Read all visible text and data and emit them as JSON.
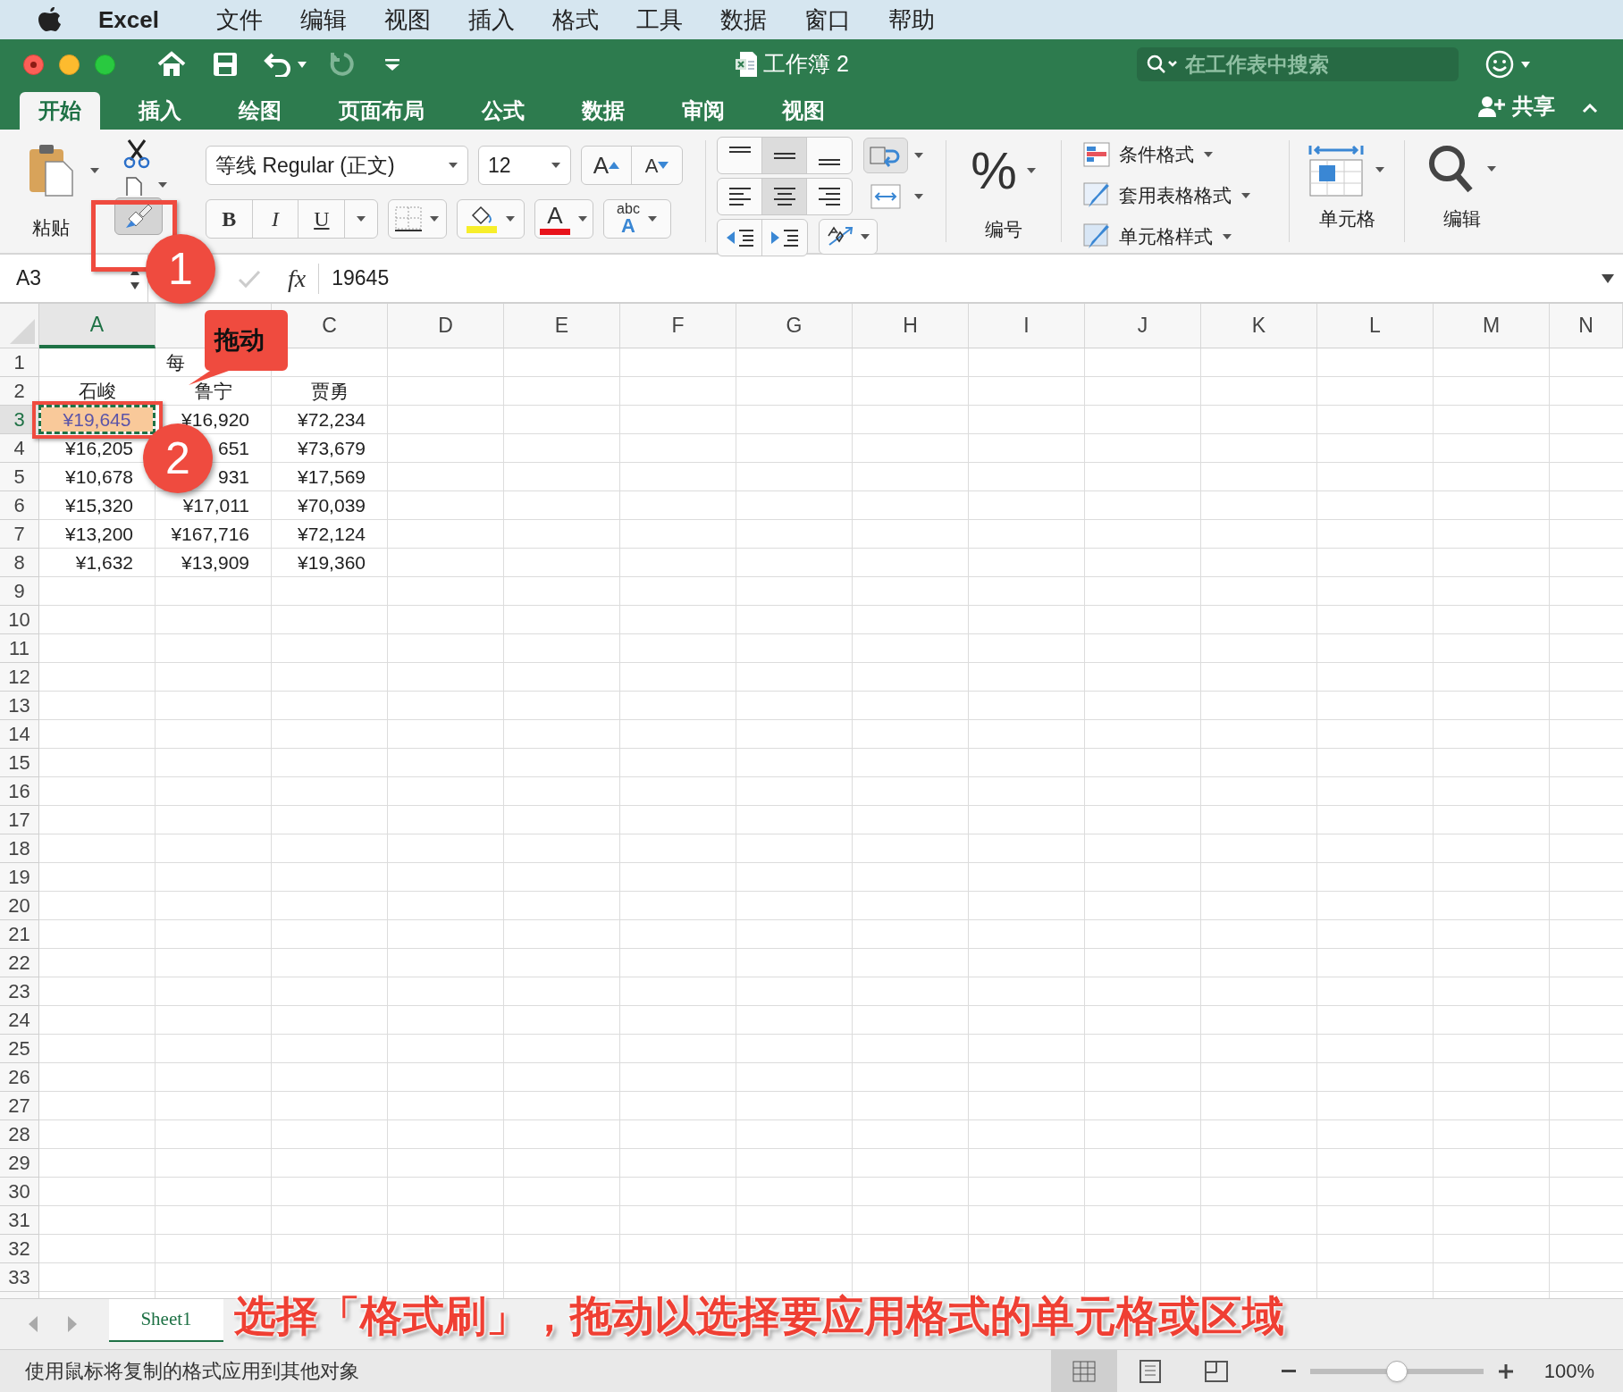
{
  "menu_bar": {
    "app": "Excel",
    "items": [
      "文件",
      "编辑",
      "视图",
      "插入",
      "格式",
      "工具",
      "数据",
      "窗口",
      "帮助"
    ]
  },
  "title_bar": {
    "title": "工作簿 2",
    "search": {
      "placeholder": "在工作表中搜索"
    }
  },
  "tabs": [
    {
      "label": "开始",
      "selected": true
    },
    {
      "label": "插入",
      "selected": false
    },
    {
      "label": "绘图",
      "selected": false
    },
    {
      "label": "页面布局",
      "selected": false
    },
    {
      "label": "公式",
      "selected": false
    },
    {
      "label": "数据",
      "selected": false
    },
    {
      "label": "审阅",
      "selected": false
    },
    {
      "label": "视图",
      "selected": false
    }
  ],
  "share": "共享",
  "ribbon": {
    "paste": "粘贴",
    "format_painter": {
      "selected": true
    },
    "font_name": "等线 Regular (正文)",
    "font_size": "12",
    "grow": "A",
    "shrink": "A",
    "styles_buttons": [
      "B",
      "I",
      "U"
    ],
    "font_color": "A",
    "abc": "abc",
    "abc_letter": "A",
    "align_vertical": [
      {
        "kind": "top",
        "selected": false
      },
      {
        "kind": "middle",
        "selected": true
      },
      {
        "kind": "bottom",
        "selected": false
      }
    ],
    "align_horizontal": [
      {
        "kind": "left",
        "selected": false
      },
      {
        "kind": "center",
        "selected": true
      },
      {
        "kind": "right",
        "selected": false
      }
    ],
    "number_symbol": "%",
    "number": "编号",
    "styles": [
      "条件格式",
      "套用表格格式",
      "单元格样式"
    ],
    "cells": "单元格",
    "editing": "编辑"
  },
  "formula_bar": {
    "name_box": "A3",
    "fx": "fx",
    "value": "19645"
  },
  "columns": [
    {
      "label": "A",
      "selected": true
    },
    {
      "selected": false
    },
    {
      "label": "C",
      "selected": false
    },
    {
      "label": "D",
      "selected": false
    },
    {
      "label": "E",
      "selected": false
    },
    {
      "label": "F",
      "selected": false
    },
    {
      "label": "G",
      "selected": false
    },
    {
      "label": "H",
      "selected": false
    },
    {
      "label": "I",
      "selected": false
    },
    {
      "label": "J",
      "selected": false
    },
    {
      "label": "K",
      "selected": false
    },
    {
      "label": "L",
      "selected": false
    },
    {
      "label": "M",
      "selected": false
    },
    {
      "label": "N",
      "selected": false
    }
  ],
  "rows": [
    {
      "number": "1",
      "kind": "title",
      "selected": false,
      "cells": [
        "",
        "每",
        ""
      ]
    },
    {
      "number": "2",
      "kind": "header",
      "selected": false,
      "cells": [
        "石峻",
        "鲁宁",
        "贾勇"
      ]
    },
    {
      "number": "3",
      "kind": "data",
      "selected": true,
      "cells": [
        "¥19,645",
        "¥16,920",
        "¥72,234"
      ]
    },
    {
      "number": "4",
      "kind": "data",
      "selected": false,
      "cells": [
        "¥16,205",
        "651",
        "¥73,679"
      ]
    },
    {
      "number": "5",
      "kind": "data",
      "selected": false,
      "cells": [
        "¥10,678",
        "931",
        "¥17,569"
      ]
    },
    {
      "number": "6",
      "kind": "data",
      "selected": false,
      "cells": [
        "¥15,320",
        "¥17,011",
        "¥70,039"
      ]
    },
    {
      "number": "7",
      "kind": "data",
      "selected": false,
      "cells": [
        "¥13,200",
        "¥167,716",
        "¥72,124"
      ]
    },
    {
      "number": "8",
      "kind": "data",
      "selected": false,
      "cells": [
        "¥1,632",
        "¥13,909",
        "¥19,360"
      ]
    },
    {
      "number": "9",
      "selected": false
    },
    {
      "number": "10",
      "selected": false
    },
    {
      "number": "11",
      "selected": false
    },
    {
      "number": "12",
      "selected": false
    },
    {
      "number": "13",
      "selected": false
    },
    {
      "number": "14",
      "selected": false
    },
    {
      "number": "15",
      "selected": false
    },
    {
      "number": "16",
      "selected": false
    },
    {
      "number": "17",
      "selected": false
    },
    {
      "number": "18",
      "selected": false
    },
    {
      "number": "19",
      "selected": false
    },
    {
      "number": "20",
      "selected": false
    },
    {
      "number": "21",
      "selected": false
    },
    {
      "number": "22",
      "selected": false
    },
    {
      "number": "23",
      "selected": false
    },
    {
      "number": "24",
      "selected": false
    },
    {
      "number": "25",
      "selected": false
    },
    {
      "number": "26",
      "selected": false
    },
    {
      "number": "27",
      "selected": false
    },
    {
      "number": "28",
      "selected": false
    },
    {
      "number": "29",
      "selected": false
    },
    {
      "number": "30",
      "selected": false
    },
    {
      "number": "31",
      "selected": false
    },
    {
      "number": "32",
      "selected": false
    },
    {
      "number": "33",
      "selected": false
    }
  ],
  "sheet_tabs": [
    {
      "label": "Sheet1",
      "selected": true
    }
  ],
  "annotations": {
    "markers": [
      "1",
      "2"
    ],
    "callout": "拖动",
    "caption": "选择「格式刷」，拖动以选择要应用格式的单元格或区域"
  },
  "status_bar": {
    "message": "使用鼠标将复制的格式应用到其他对象",
    "views": [
      {
        "kind": "normal",
        "selected": true
      },
      {
        "kind": "page_layout",
        "selected": false
      },
      {
        "kind": "page_break",
        "selected": false
      }
    ],
    "zoom_slider": {
      "level": 0.5
    },
    "zoom": "100%"
  }
}
